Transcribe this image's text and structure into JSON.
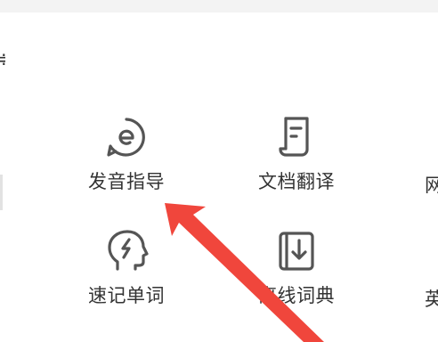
{
  "tools": [
    {
      "label": "发音指导",
      "icon": "pronunciation-icon"
    },
    {
      "label": "文档翻译",
      "icon": "document-icon"
    },
    {
      "label": "网",
      "icon": "web-icon"
    },
    {
      "label": "速记单词",
      "icon": "memory-head-icon"
    },
    {
      "label": "离线词典",
      "icon": "download-icon"
    },
    {
      "label": "英",
      "icon": "english-icon"
    }
  ],
  "edge_glyph": "≑",
  "colors": {
    "icon_stroke": "#555555",
    "text": "#333333",
    "arrow": "#f0463c",
    "top_strip": "#f3f3f3"
  }
}
